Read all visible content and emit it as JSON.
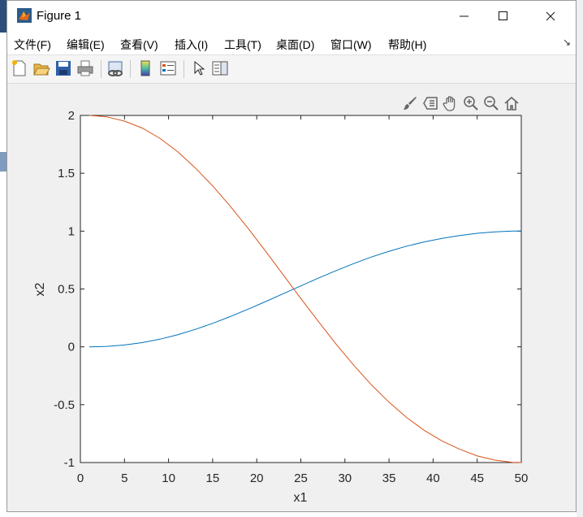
{
  "window": {
    "title": "Figure 1"
  },
  "menu": [
    "文件(F)",
    "编辑(E)",
    "查看(V)",
    "插入(I)",
    "工具(T)",
    "桌面(D)",
    "窗口(W)",
    "帮助(H)"
  ],
  "toolbar_icons": [
    "new-figure-icon",
    "open-file-icon",
    "save-icon",
    "print-icon",
    "link-plot-icon",
    "colorbar-icon",
    "legend-icon",
    "edit-pointer-icon",
    "property-inspector-icon"
  ],
  "axes_toolbar_icons": [
    "brush-icon",
    "data-tips-icon",
    "pan-icon",
    "zoom-in-icon",
    "zoom-out-icon",
    "home-icon"
  ],
  "chart_data": {
    "type": "line",
    "xlabel": "x1",
    "ylabel": "x2",
    "xlim": [
      0,
      50
    ],
    "ylim": [
      -1,
      2
    ],
    "xticks": [
      "0",
      "5",
      "10",
      "15",
      "20",
      "25",
      "30",
      "35",
      "40",
      "45",
      "50"
    ],
    "yticks": [
      "2",
      "1.5",
      "1",
      "0.5",
      "0",
      "-0.5",
      "-1"
    ],
    "series": [
      {
        "color": "#0072bd",
        "x": [
          1,
          3,
          5,
          7,
          9,
          11,
          13,
          15,
          17,
          19,
          21,
          23,
          25,
          27,
          29,
          31,
          33,
          35,
          37,
          39,
          41,
          43,
          45,
          47,
          49,
          50
        ],
        "y": [
          0.0,
          0.004,
          0.016,
          0.036,
          0.066,
          0.104,
          0.15,
          0.203,
          0.262,
          0.325,
          0.391,
          0.459,
          0.527,
          0.594,
          0.659,
          0.72,
          0.776,
          0.826,
          0.87,
          0.907,
          0.938,
          0.962,
          0.981,
          0.994,
          1.0,
          1.0
        ]
      },
      {
        "color": "#d95319",
        "x": [
          1,
          3,
          5,
          7,
          9,
          11,
          13,
          15,
          17,
          19,
          21,
          23,
          25,
          27,
          29,
          31,
          33,
          35,
          37,
          39,
          41,
          43,
          45,
          47,
          49,
          50
        ],
        "y": [
          2.0,
          1.988,
          1.951,
          1.891,
          1.803,
          1.688,
          1.549,
          1.391,
          1.215,
          1.026,
          0.826,
          0.622,
          0.418,
          0.218,
          0.024,
          -0.159,
          -0.328,
          -0.479,
          -0.611,
          -0.722,
          -0.813,
          -0.885,
          -0.943,
          -0.979,
          -0.998,
          -1.0
        ]
      }
    ]
  }
}
